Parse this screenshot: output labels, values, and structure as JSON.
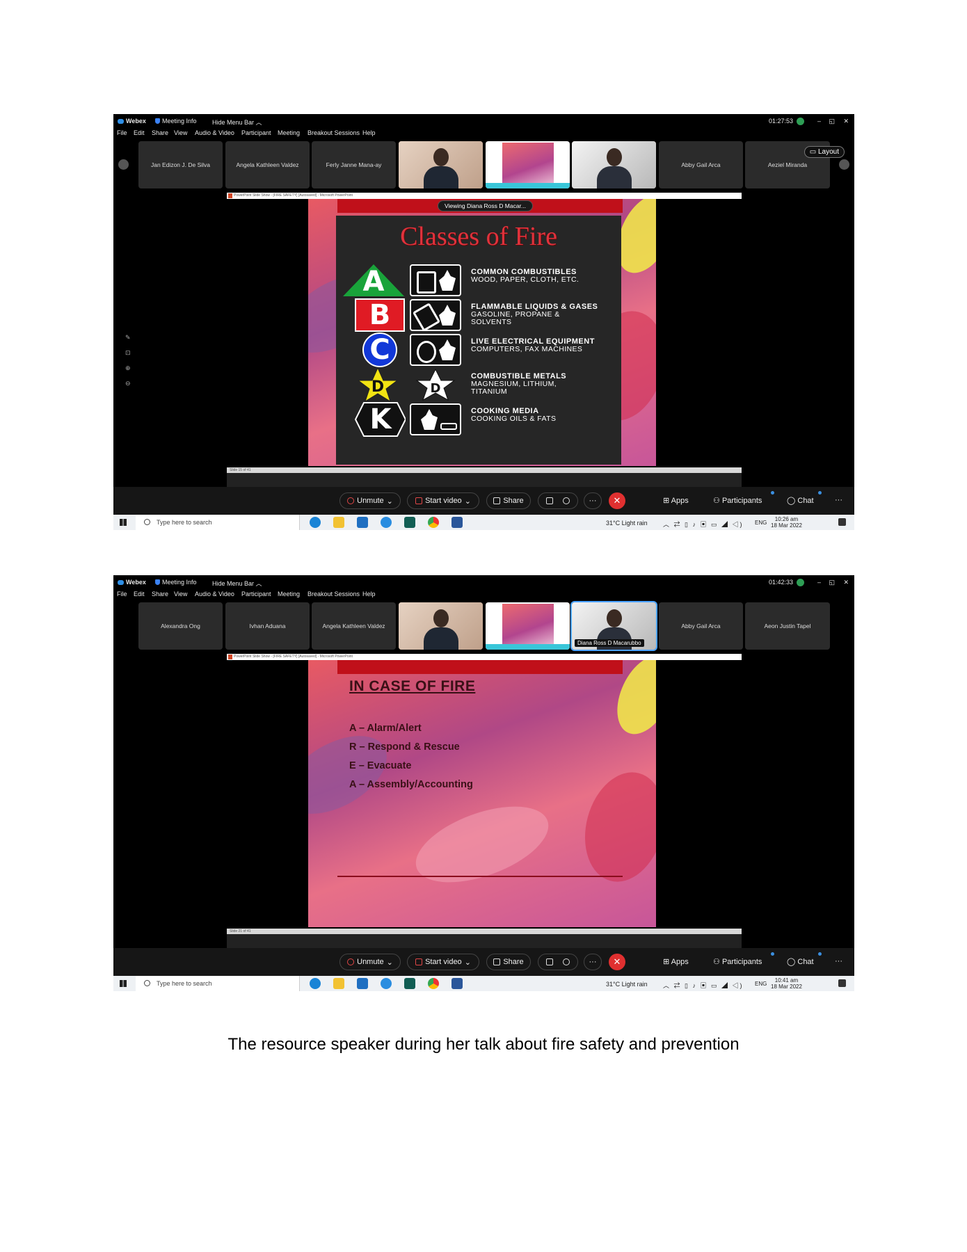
{
  "caption": "The resource speaker during her talk about fire safety and prevention",
  "colors": {
    "accent": "#2f8fe6",
    "end_call": "#e03030",
    "slide_red_bar": "#c0101a",
    "title_red": "#e0323c"
  },
  "screens": [
    {
      "app_name": "Webex",
      "meeting_info": "Meeting Info",
      "hide_menu_bar": "Hide Menu Bar",
      "timer": "01:27:53",
      "menu": [
        "File",
        "Edit",
        "Share",
        "View",
        "Audio & Video",
        "Participant",
        "Meeting",
        "Breakout Sessions",
        "Help"
      ],
      "participants": [
        "Jan Edizon J. De Silva",
        "Angela Kathleen Valdez",
        "Ferly Janne Mana-ay",
        "Abby Gail Arca",
        "Aeziel Miranda"
      ],
      "layout_label": "Layout",
      "viewing": "Viewing Diana Ross D Macar...",
      "ppt_window_title": "PowerPoint Slide Show - [FIRE SAFETY] [Autosaved] - Microsoft PowerPoint",
      "status": "Slide 15 of 41",
      "slide": {
        "title": "Classes of Fire",
        "classes": [
          {
            "letter": "A",
            "line1": "COMMON COMBUSTIBLES",
            "line2": "WOOD, PAPER, CLOTH, ETC.",
            "line3": ""
          },
          {
            "letter": "B",
            "line1": "FLAMMABLE LIQUIDS & GASES",
            "line2": "GASOLINE, PROPANE &",
            "line3": "SOLVENTS"
          },
          {
            "letter": "C",
            "line1": "LIVE ELECTRICAL EQUIPMENT",
            "line2": "COMPUTERS, FAX MACHINES",
            "line3": ""
          },
          {
            "letter": "D",
            "line1": "COMBUSTIBLE METALS",
            "line2": "MAGNESIUM, LITHIUM,",
            "line3": "TITANIUM"
          },
          {
            "letter": "K",
            "line1": "COOKING MEDIA",
            "line2": "COOKING OILS & FATS",
            "line3": ""
          }
        ]
      },
      "controls": {
        "unmute": "Unmute",
        "start_video": "Start video",
        "share": "Share",
        "apps": "Apps",
        "participants": "Participants",
        "chat": "Chat",
        "more": "···"
      },
      "taskbar": {
        "search_placeholder": "Type here to search",
        "weather": "31°C  Light rain",
        "lang": "ENG",
        "time": "10:26 am",
        "date": "18 Mar 2022"
      }
    },
    {
      "app_name": "Webex",
      "meeting_info": "Meeting Info",
      "hide_menu_bar": "Hide Menu Bar",
      "timer": "01:42:33",
      "menu": [
        "File",
        "Edit",
        "Share",
        "View",
        "Audio & Video",
        "Participant",
        "Meeting",
        "Breakout Sessions",
        "Help"
      ],
      "participants": [
        "Alexandra Ong",
        "Ivhan Aduana",
        "Angela Kathleen Valdez",
        "Abby Gail Arca",
        "Aeon Justin Tapel"
      ],
      "speaker_name": "Diana Ross D Macarubbo",
      "ppt_window_title": "PowerPoint Slide Show - [FIRE SAFETY] [Autosaved] - Microsoft PowerPoint",
      "status": "Slide 21 of 41",
      "slide": {
        "title": "IN CASE OF FIRE",
        "items": [
          "A – Alarm/Alert",
          "R – Respond & Rescue",
          "E – Evacuate",
          "A – Assembly/Accounting"
        ]
      },
      "controls": {
        "unmute": "Unmute",
        "start_video": "Start video",
        "share": "Share",
        "apps": "Apps",
        "participants": "Participants",
        "chat": "Chat",
        "more": "···"
      },
      "taskbar": {
        "search_placeholder": "Type here to search",
        "weather": "31°C  Light rain",
        "lang": "ENG",
        "time": "10:41 am",
        "date": "18 Mar 2022"
      }
    }
  ]
}
